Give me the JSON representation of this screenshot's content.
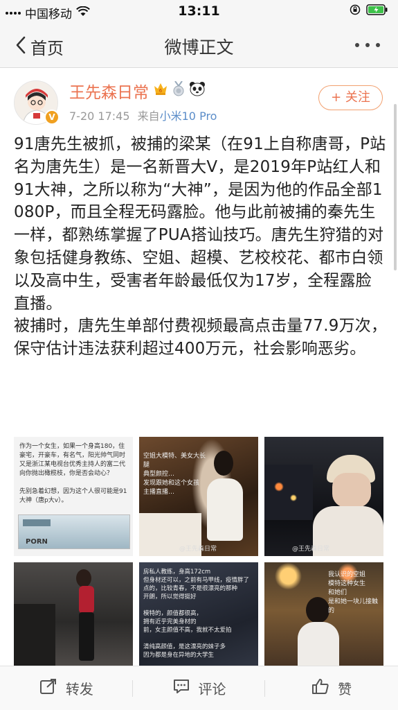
{
  "status": {
    "carrier": "中国移动",
    "time": "13:11"
  },
  "nav": {
    "back_label": "首页",
    "title": "微博正文"
  },
  "post": {
    "username": "王先森日常",
    "time": "7-20 17:45",
    "source_prefix": "来自",
    "source": "小米10 Pro",
    "follow_label": "+ 关注",
    "text": "91唐先生被抓，被捕的梁某（在91上自称唐哥，P站名为唐先生）是一名新晋大V，是2019年P站红人和91大神，之所以称为“大神”，是因为他的作品全部1080P，而且全程无码露脸。他与此前被捕的秦先生一样，都熟练掌握了PUA搭讪技巧。唐先生狩猎的对象包括健身教练、空姐、超模、艺校校花、都市白领以及高中生，受害者年龄最低仅为17岁，全程露脸直播。\n被捕时，唐先生单部付费视频最高点击量77.9万次，保守估计违法获利超过400万元，社会影响恶劣。"
  },
  "images": [
    {
      "caption": "作为一个女生，如果一个身高180，住豪宅，开豪车，有名气，阳光帅气同时又是浙江某电视台优秀主持人的富二代向你抛出橄榄枝，你是否会动心？\n\n先别急着幻想，因为这个人很可能是91大神（唐p大v）。",
      "caption2": "PORN"
    },
    {
      "caption": "空姐大模特、美女大长腿\n典型颜控…\n发现跟她和这个女孩\n主播直播…",
      "caption2": "@王先森日常"
    },
    {
      "caption": "",
      "caption2": "@王先森日常"
    },
    {
      "caption": "",
      "caption2": ""
    },
    {
      "caption": "房私人教练，身高172cm\n但身材还可以，之前有马甲线，疫情胖了点的，比较青春，不是很漂亮的那种\n开朗，所以觉得挺好\n\n模特的，颜值都很高，\n拥有近乎完美身材的\n前，女主颜值不高，我就不太爱拍\n\n清纯高颜值，是这漂亮的妹子多\n因为都是身在异地的大学生",
      "caption2": ""
    },
    {
      "caption": "我认识的空姐\n模特这种女生\n和她们\n是和她一块儿接触的",
      "caption2": ""
    }
  ],
  "toolbar": {
    "repost": "转发",
    "comment": "评论",
    "like": "赞"
  }
}
